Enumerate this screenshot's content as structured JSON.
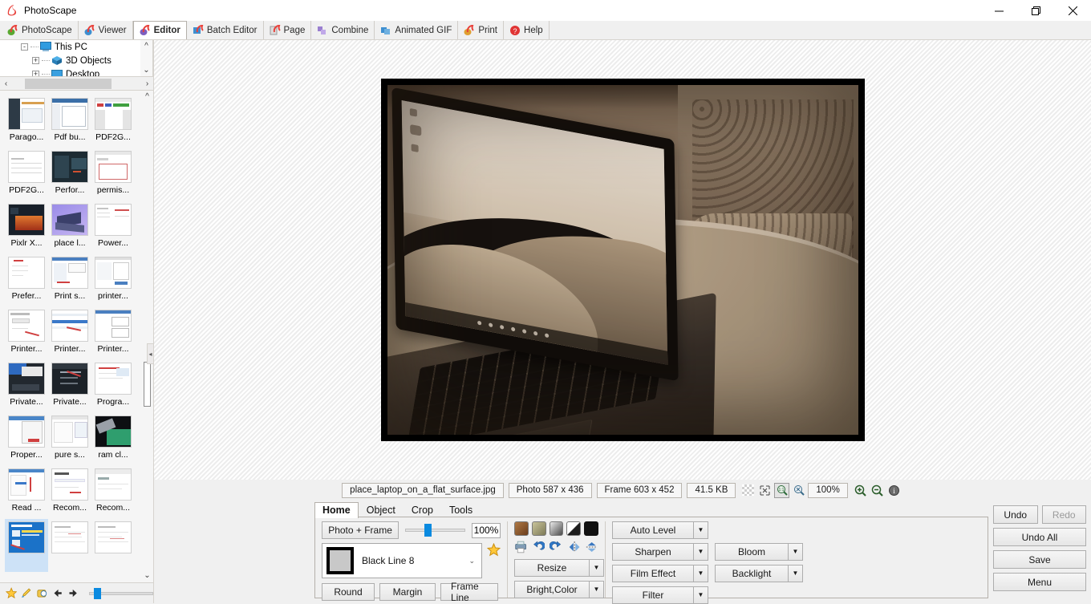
{
  "window": {
    "title": "PhotoScape",
    "app_icon": "photoscape-logo-icon",
    "minimize": "minimize-icon",
    "maximize": "restore-icon",
    "close": "close-icon"
  },
  "modules": [
    {
      "label": "PhotoScape",
      "icon": "photoscape-icon",
      "active": false
    },
    {
      "label": "Viewer",
      "icon": "viewer-icon",
      "active": false
    },
    {
      "label": "Editor",
      "icon": "editor-icon",
      "active": true
    },
    {
      "label": "Batch Editor",
      "icon": "batch-editor-icon",
      "active": false
    },
    {
      "label": "Page",
      "icon": "page-icon",
      "active": false
    },
    {
      "label": "Combine",
      "icon": "combine-icon",
      "active": false
    },
    {
      "label": "Animated GIF",
      "icon": "animated-gif-icon",
      "active": false
    },
    {
      "label": "Print",
      "icon": "print-icon",
      "active": false
    },
    {
      "label": "Help",
      "icon": "help-icon",
      "active": false
    }
  ],
  "tree": {
    "items": [
      {
        "label": "This PC",
        "icon": "pc-icon",
        "expander": "-",
        "indent": 0
      },
      {
        "label": "3D Objects",
        "icon": "folder3d-icon",
        "expander": "+",
        "indent": 1
      },
      {
        "label": "Desktop",
        "icon": "folder-icon",
        "expander": "+",
        "indent": 1
      }
    ],
    "scroll_up": "chevron-up-icon",
    "scroll_down": "chevron-down-icon",
    "hscroll_left": "chevron-left-icon",
    "hscroll_right": "chevron-right-icon"
  },
  "thumbnails": [
    {
      "name": "Parago...",
      "selected": false
    },
    {
      "name": "Pdf bu...",
      "selected": false
    },
    {
      "name": "PDF2G...",
      "selected": false
    },
    {
      "name": "PDF2G...",
      "selected": false
    },
    {
      "name": "Perfor...",
      "selected": false
    },
    {
      "name": "permis...",
      "selected": false
    },
    {
      "name": "Pixlr X...",
      "selected": false
    },
    {
      "name": "place l...",
      "selected": false
    },
    {
      "name": "Power...",
      "selected": false
    },
    {
      "name": "Prefer...",
      "selected": false
    },
    {
      "name": "Print s...",
      "selected": false
    },
    {
      "name": "printer...",
      "selected": false
    },
    {
      "name": "Printer...",
      "selected": false
    },
    {
      "name": "Printer...",
      "selected": false
    },
    {
      "name": "Printer...",
      "selected": false
    },
    {
      "name": "Private...",
      "selected": false
    },
    {
      "name": "Private...",
      "selected": false
    },
    {
      "name": "Progra...",
      "selected": false
    },
    {
      "name": "Proper...",
      "selected": false
    },
    {
      "name": "pure s...",
      "selected": false
    },
    {
      "name": "ram cl...",
      "selected": false
    },
    {
      "name": "Read ...",
      "selected": false
    },
    {
      "name": "Recom...",
      "selected": false
    },
    {
      "name": "Recom...",
      "selected": false
    },
    {
      "name": "",
      "selected": true
    },
    {
      "name": "",
      "selected": false
    },
    {
      "name": "",
      "selected": false
    }
  ],
  "left_toolbar": {
    "icons": [
      {
        "name": "favorite-star-icon"
      },
      {
        "name": "rename-icon"
      },
      {
        "name": "slideshow-icon"
      },
      {
        "name": "back-arrow-icon"
      },
      {
        "name": "forward-arrow-icon"
      }
    ],
    "zoom_slider_value": 10
  },
  "statusbar": {
    "filename": "place_laptop_on_a_flat_surface.jpg",
    "photo_size": "Photo 587 x 436",
    "frame_size": "Frame 603 x 452",
    "filesize": "41.5 KB",
    "zoom_level": "100%",
    "icons": [
      {
        "name": "transparency-checker-icon"
      },
      {
        "name": "fit-screen-icon"
      },
      {
        "name": "zoom-100-icon",
        "active": true
      },
      {
        "name": "zoom-fit-icon"
      },
      {
        "name": "zoom-in-icon"
      },
      {
        "name": "zoom-out-icon"
      },
      {
        "name": "info-icon"
      }
    ]
  },
  "editor": {
    "tabs": [
      {
        "label": "Home",
        "active": true
      },
      {
        "label": "Object",
        "active": false
      },
      {
        "label": "Crop",
        "active": false
      },
      {
        "label": "Tools",
        "active": false
      }
    ],
    "frame_group": {
      "photo_frame_button": "Photo + Frame",
      "opacity_value": "100%",
      "opacity_slider": 28,
      "frame_preset": "Black Line 8",
      "favorite_icon": "favorite-star-icon",
      "dropdown_icon": "chevron-down-icon",
      "round_button": "Round",
      "margin_button": "Margin",
      "frame_line_button": "Frame Line"
    },
    "adjust_group": {
      "swatches": [
        {
          "name": "sepia-swatch",
          "color": "#8a5c33"
        },
        {
          "name": "olive-swatch",
          "color": "#a8a37f"
        },
        {
          "name": "grayscale-swatch",
          "color": "#9b9b9b"
        },
        {
          "name": "diagonal-split-swatch",
          "color": "#cfcfcf"
        },
        {
          "name": "invert-swatch",
          "color": "#000000"
        }
      ],
      "icons": [
        {
          "name": "print-preview-icon"
        },
        {
          "name": "rotate-left-icon"
        },
        {
          "name": "rotate-right-icon"
        },
        {
          "name": "flip-horizontal-icon"
        },
        {
          "name": "flip-vertical-icon"
        }
      ],
      "resize_button": "Resize",
      "bright_color_button": "Bright,Color"
    },
    "effects_group": {
      "auto_level": "Auto Level",
      "sharpen": "Sharpen",
      "film_effect": "Film Effect",
      "filter": "Filter",
      "bloom": "Bloom",
      "backlight": "Backlight"
    },
    "actions": {
      "undo": "Undo",
      "redo": "Redo",
      "redo_disabled": true,
      "undo_all": "Undo All",
      "save": "Save",
      "menu": "Menu"
    }
  },
  "colors": {
    "accent": "#0a8ae0",
    "window_bg": "#f0f0f0",
    "panel_border": "#b4b0aa",
    "selection": "#cde2f7"
  }
}
